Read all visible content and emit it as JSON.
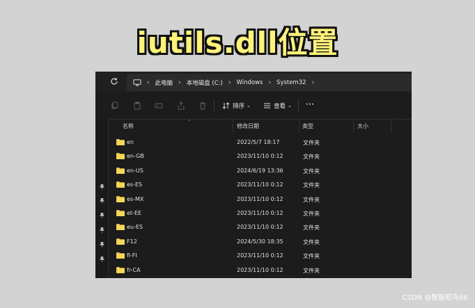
{
  "banner_title": "iutils.dll位置",
  "address_bar": {
    "crumbs": [
      "此电脑",
      "本地磁盘 (C:)",
      "Windows",
      "System32"
    ]
  },
  "toolbar": {
    "sort_label": "排序",
    "view_label": "查看",
    "more_label": "···"
  },
  "columns": {
    "name": "名称",
    "modified": "修改日期",
    "type": "类型",
    "size": "大小"
  },
  "files": [
    {
      "name": "en",
      "modified": "2022/5/7 18:17",
      "type": "文件夹"
    },
    {
      "name": "en-GB",
      "modified": "2023/11/10 0:12",
      "type": "文件夹"
    },
    {
      "name": "en-US",
      "modified": "2024/6/19 13:36",
      "type": "文件夹"
    },
    {
      "name": "es-ES",
      "modified": "2023/11/10 0:12",
      "type": "文件夹"
    },
    {
      "name": "es-MX",
      "modified": "2023/11/10 0:12",
      "type": "文件夹"
    },
    {
      "name": "et-EE",
      "modified": "2023/11/10 0:12",
      "type": "文件夹"
    },
    {
      "name": "eu-ES",
      "modified": "2023/11/10 0:12",
      "type": "文件夹"
    },
    {
      "name": "F12",
      "modified": "2024/5/30 18:35",
      "type": "文件夹"
    },
    {
      "name": "fi-FI",
      "modified": "2023/11/10 0:12",
      "type": "文件夹"
    },
    {
      "name": "fr-CA",
      "modified": "2023/11/10 0:12",
      "type": "文件夹"
    }
  ],
  "colors": {
    "folder": "#f2c94c",
    "window_bg": "#1c1c1c",
    "banner_text": "#fdf27a"
  },
  "watermark": "CSDN @智能知鸟66"
}
